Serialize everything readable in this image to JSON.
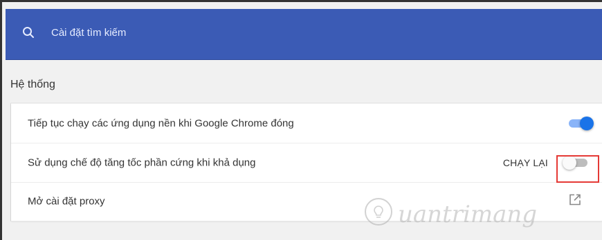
{
  "header": {
    "search_placeholder": "Cài đặt tìm kiếm",
    "search_icon": "search-icon",
    "background_color": "#3b5bb5"
  },
  "section": {
    "title": "Hệ thống"
  },
  "settings": {
    "items": [
      {
        "label": "Tiếp tục chạy các ứng dụng nền khi Google Chrome đóng",
        "control": "toggle",
        "state": "on"
      },
      {
        "label": "Sử dụng chế độ tăng tốc phần cứng khi khả dụng",
        "action_label": "CHẠY LẠI",
        "control": "toggle",
        "state": "off",
        "highlighted": true,
        "highlight_color": "#e53935"
      },
      {
        "label": "Mở cài đặt proxy",
        "control": "external-link",
        "icon": "external-link-icon"
      }
    ]
  },
  "watermark": {
    "text": "uantrimang",
    "logo_icon": "lightbulb-icon"
  }
}
